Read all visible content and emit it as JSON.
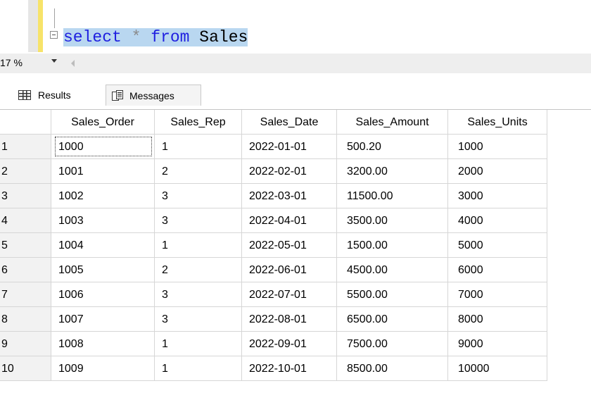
{
  "editor": {
    "query_tokens": [
      {
        "text": "select",
        "type": "keyword"
      },
      {
        "text": " ",
        "type": "space"
      },
      {
        "text": "*",
        "type": "operator"
      },
      {
        "text": " ",
        "type": "space"
      },
      {
        "text": "from",
        "type": "keyword"
      },
      {
        "text": " ",
        "type": "space"
      },
      {
        "text": "Sales",
        "type": "identifier"
      }
    ]
  },
  "zoom": {
    "label": "17 %"
  },
  "tabs": {
    "results": "Results",
    "messages": "Messages"
  },
  "grid": {
    "columns": [
      "Sales_Order",
      "Sales_Rep",
      "Sales_Date",
      "Sales_Amount",
      "Sales_Units"
    ],
    "rows": [
      {
        "num": "1",
        "cells": [
          "1000",
          "1",
          "2022-01-01",
          "500.20",
          "1000"
        ]
      },
      {
        "num": "2",
        "cells": [
          "1001",
          "2",
          "2022-02-01",
          "3200.00",
          "2000"
        ]
      },
      {
        "num": "3",
        "cells": [
          "1002",
          "3",
          "2022-03-01",
          "11500.00",
          "3000"
        ]
      },
      {
        "num": "4",
        "cells": [
          "1003",
          "3",
          "2022-04-01",
          "3500.00",
          "4000"
        ]
      },
      {
        "num": "5",
        "cells": [
          "1004",
          "1",
          "2022-05-01",
          "1500.00",
          "5000"
        ]
      },
      {
        "num": "6",
        "cells": [
          "1005",
          "2",
          "2022-06-01",
          "4500.00",
          "6000"
        ]
      },
      {
        "num": "7",
        "cells": [
          "1006",
          "3",
          "2022-07-01",
          "5500.00",
          "7000"
        ]
      },
      {
        "num": "8",
        "cells": [
          "1007",
          "3",
          "2022-08-01",
          "6500.00",
          "8000"
        ]
      },
      {
        "num": "9",
        "cells": [
          "1008",
          "1",
          "2022-09-01",
          "7500.00",
          "9000"
        ]
      },
      {
        "num": "10",
        "cells": [
          "1009",
          "1",
          "2022-10-01",
          "8500.00",
          "10000"
        ]
      }
    ]
  },
  "colors": {
    "keyword": "#1f1fe0",
    "operator": "#8a8a8a",
    "selection": "#b9d7f0",
    "gutter_change_marker": "#f7e36a"
  }
}
